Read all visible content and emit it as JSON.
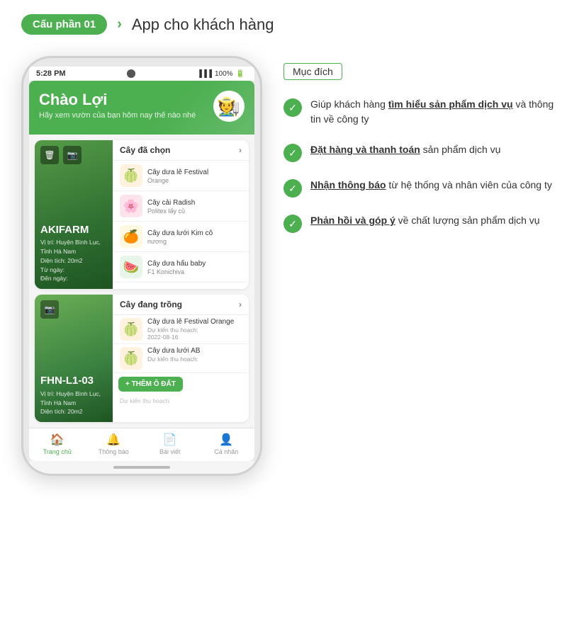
{
  "header": {
    "badge": "Cấu phần 01",
    "title": "App cho khách hàng"
  },
  "phone": {
    "status_bar": {
      "time": "5:28 PM",
      "signal": "📶",
      "battery": "100%"
    },
    "app": {
      "greeting": "Chào Lợi",
      "sub_greeting": "Hãy xem vườn của bạn hôm nay thế nào nhé",
      "avatar_icon": "🧑‍🌾",
      "farm1": {
        "name": "AKIFARM",
        "location": "Vị trí: Huyện Bình Lục, Tỉnh Hà Nam",
        "area": "Diện tích: 20m2",
        "from": "Từ ngày:",
        "to": "Đến ngày:",
        "section_label": "Cây đã chọn",
        "plants": [
          {
            "name": "Cây dưa lê Festival",
            "sub": "Orange",
            "icon": "🍈",
            "cls": "fruit"
          },
          {
            "name": "Cây cải Radish",
            "sub": "Politex lấy củ",
            "icon": "🌸",
            "cls": "radish"
          },
          {
            "name": "Cây dưa lưới Kim cô",
            "sub": "nương",
            "icon": "🍊",
            "cls": "melon"
          },
          {
            "name": "Cây dưa hấu baby",
            "sub": "F1 Konichiva",
            "icon": "🍉",
            "cls": "watermelon"
          }
        ]
      },
      "farm2": {
        "name": "FHN-L1-03",
        "location": "Vị trí: Huyện Bình Lục, Tỉnh Hà Nam",
        "area": "Diện tích: 20m2",
        "section_label": "Cây đang trồng",
        "plants": [
          {
            "name": "Cây dưa lê Festival Orange",
            "date_label": "Dự kiến thu hoạch:",
            "date": "2022-08-16",
            "icon": "🍈",
            "cls": "fruit"
          },
          {
            "name": "Cây dưa lưới AB",
            "date_label": "Dự kiến thu hoạch:",
            "date": "",
            "icon": "🍈",
            "cls": "fruit"
          }
        ],
        "add_button": "+ THÊM Ô ĐẤT",
        "partial_label": "Dự kiến thu hoạch:"
      },
      "bottom_nav": [
        {
          "icon": "🏠",
          "label": "Trang chủ",
          "active": true
        },
        {
          "icon": "🔔",
          "label": "Thông báo",
          "active": false
        },
        {
          "icon": "📄",
          "label": "Bài viết",
          "active": false
        },
        {
          "icon": "👤",
          "label": "Cá nhân",
          "active": false
        }
      ]
    }
  },
  "right_panel": {
    "badge": "Mục đích",
    "items": [
      {
        "text_before": "",
        "underline": "tìm hiểu sản phẩm dịch vụ",
        "text_after": " và thông tin về công ty",
        "prefix": "Giúp khách hàng "
      },
      {
        "text_before": "",
        "underline": "Đặt hàng và thanh toán",
        "text_after": " sản phẩm dịch vụ",
        "prefix": ""
      },
      {
        "text_before": "",
        "underline": "Nhận thông báo",
        "text_after": " từ hệ thống và nhân viên của công ty",
        "prefix": ""
      },
      {
        "text_before": "",
        "underline": "Phản hồi và góp ý",
        "text_after": " về chất lượng sản phẩm dịch vụ",
        "prefix": ""
      }
    ]
  }
}
